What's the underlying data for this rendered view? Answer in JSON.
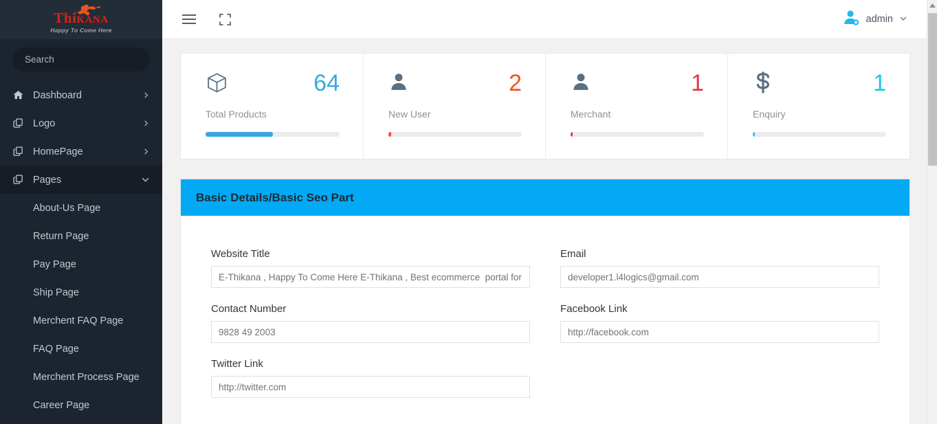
{
  "brand": {
    "name_part1": "Thi",
    "name_part2": "KANA",
    "tagline": "Happy To Come Here"
  },
  "sidebar": {
    "search_placeholder": "Search",
    "search_value": "",
    "items": [
      {
        "label": "Dashboard",
        "icon": "home-icon",
        "arrow": "chevron-right",
        "active": false
      },
      {
        "label": "Logo",
        "icon": "copy-icon",
        "arrow": "chevron-right",
        "active": false
      },
      {
        "label": "HomePage",
        "icon": "copy-icon",
        "arrow": "chevron-right",
        "active": false
      },
      {
        "label": "Pages",
        "icon": "copy-icon",
        "arrow": "chevron-down",
        "active": true
      }
    ],
    "sub_items": [
      {
        "label": "About-Us Page"
      },
      {
        "label": "Return Page"
      },
      {
        "label": "Pay Page"
      },
      {
        "label": "Ship Page"
      },
      {
        "label": "Merchent FAQ Page"
      },
      {
        "label": "FAQ Page"
      },
      {
        "label": "Merchent Process Page"
      },
      {
        "label": "Career Page"
      }
    ]
  },
  "topbar": {
    "menu_icon": "hamburger-icon",
    "fullscreen_icon": "fullscreen-icon",
    "user_name": "admin",
    "user_icon": "user-avatar-icon",
    "chevron": "chevron-down-icon"
  },
  "stats": [
    {
      "label": "Total Products",
      "value": "64",
      "icon": "box-icon",
      "color": "#36a9e1",
      "bar_percent": 50
    },
    {
      "label": "New User",
      "value": "2",
      "icon": "user-icon",
      "color": "#f4511e",
      "bar_percent": 2
    },
    {
      "label": "Merchant",
      "value": "1",
      "icon": "user-icon",
      "color": "#e8334a",
      "bar_percent": 1.5
    },
    {
      "label": "Enquiry",
      "value": "1",
      "icon": "dollar-icon",
      "color": "#23c6e8",
      "bar_percent": 1.5
    }
  ],
  "panel": {
    "title": "Basic Details/Basic Seo Part",
    "header_color": "#03a9f4",
    "fields_left": [
      {
        "label": "Website Title",
        "value": "E-Thikana , Happy To Come Here E-Thikana , Best ecommerce  portal for mo",
        "placeholder": "Website Title"
      },
      {
        "label": "Contact Number",
        "value": "9828 49 2003",
        "placeholder": "Contact Number"
      },
      {
        "label": "Twitter Link",
        "value": "http://twitter.com",
        "placeholder": "Twitter Link"
      }
    ],
    "fields_right": [
      {
        "label": "Email",
        "value": "developer1.l4logics@gmail.com",
        "placeholder": "Email"
      },
      {
        "label": "Facebook Link",
        "value": "http://facebook.com",
        "placeholder": "Facebook Link"
      }
    ]
  },
  "scrollbar": {
    "up_arrow": "scroll-up-arrow"
  }
}
